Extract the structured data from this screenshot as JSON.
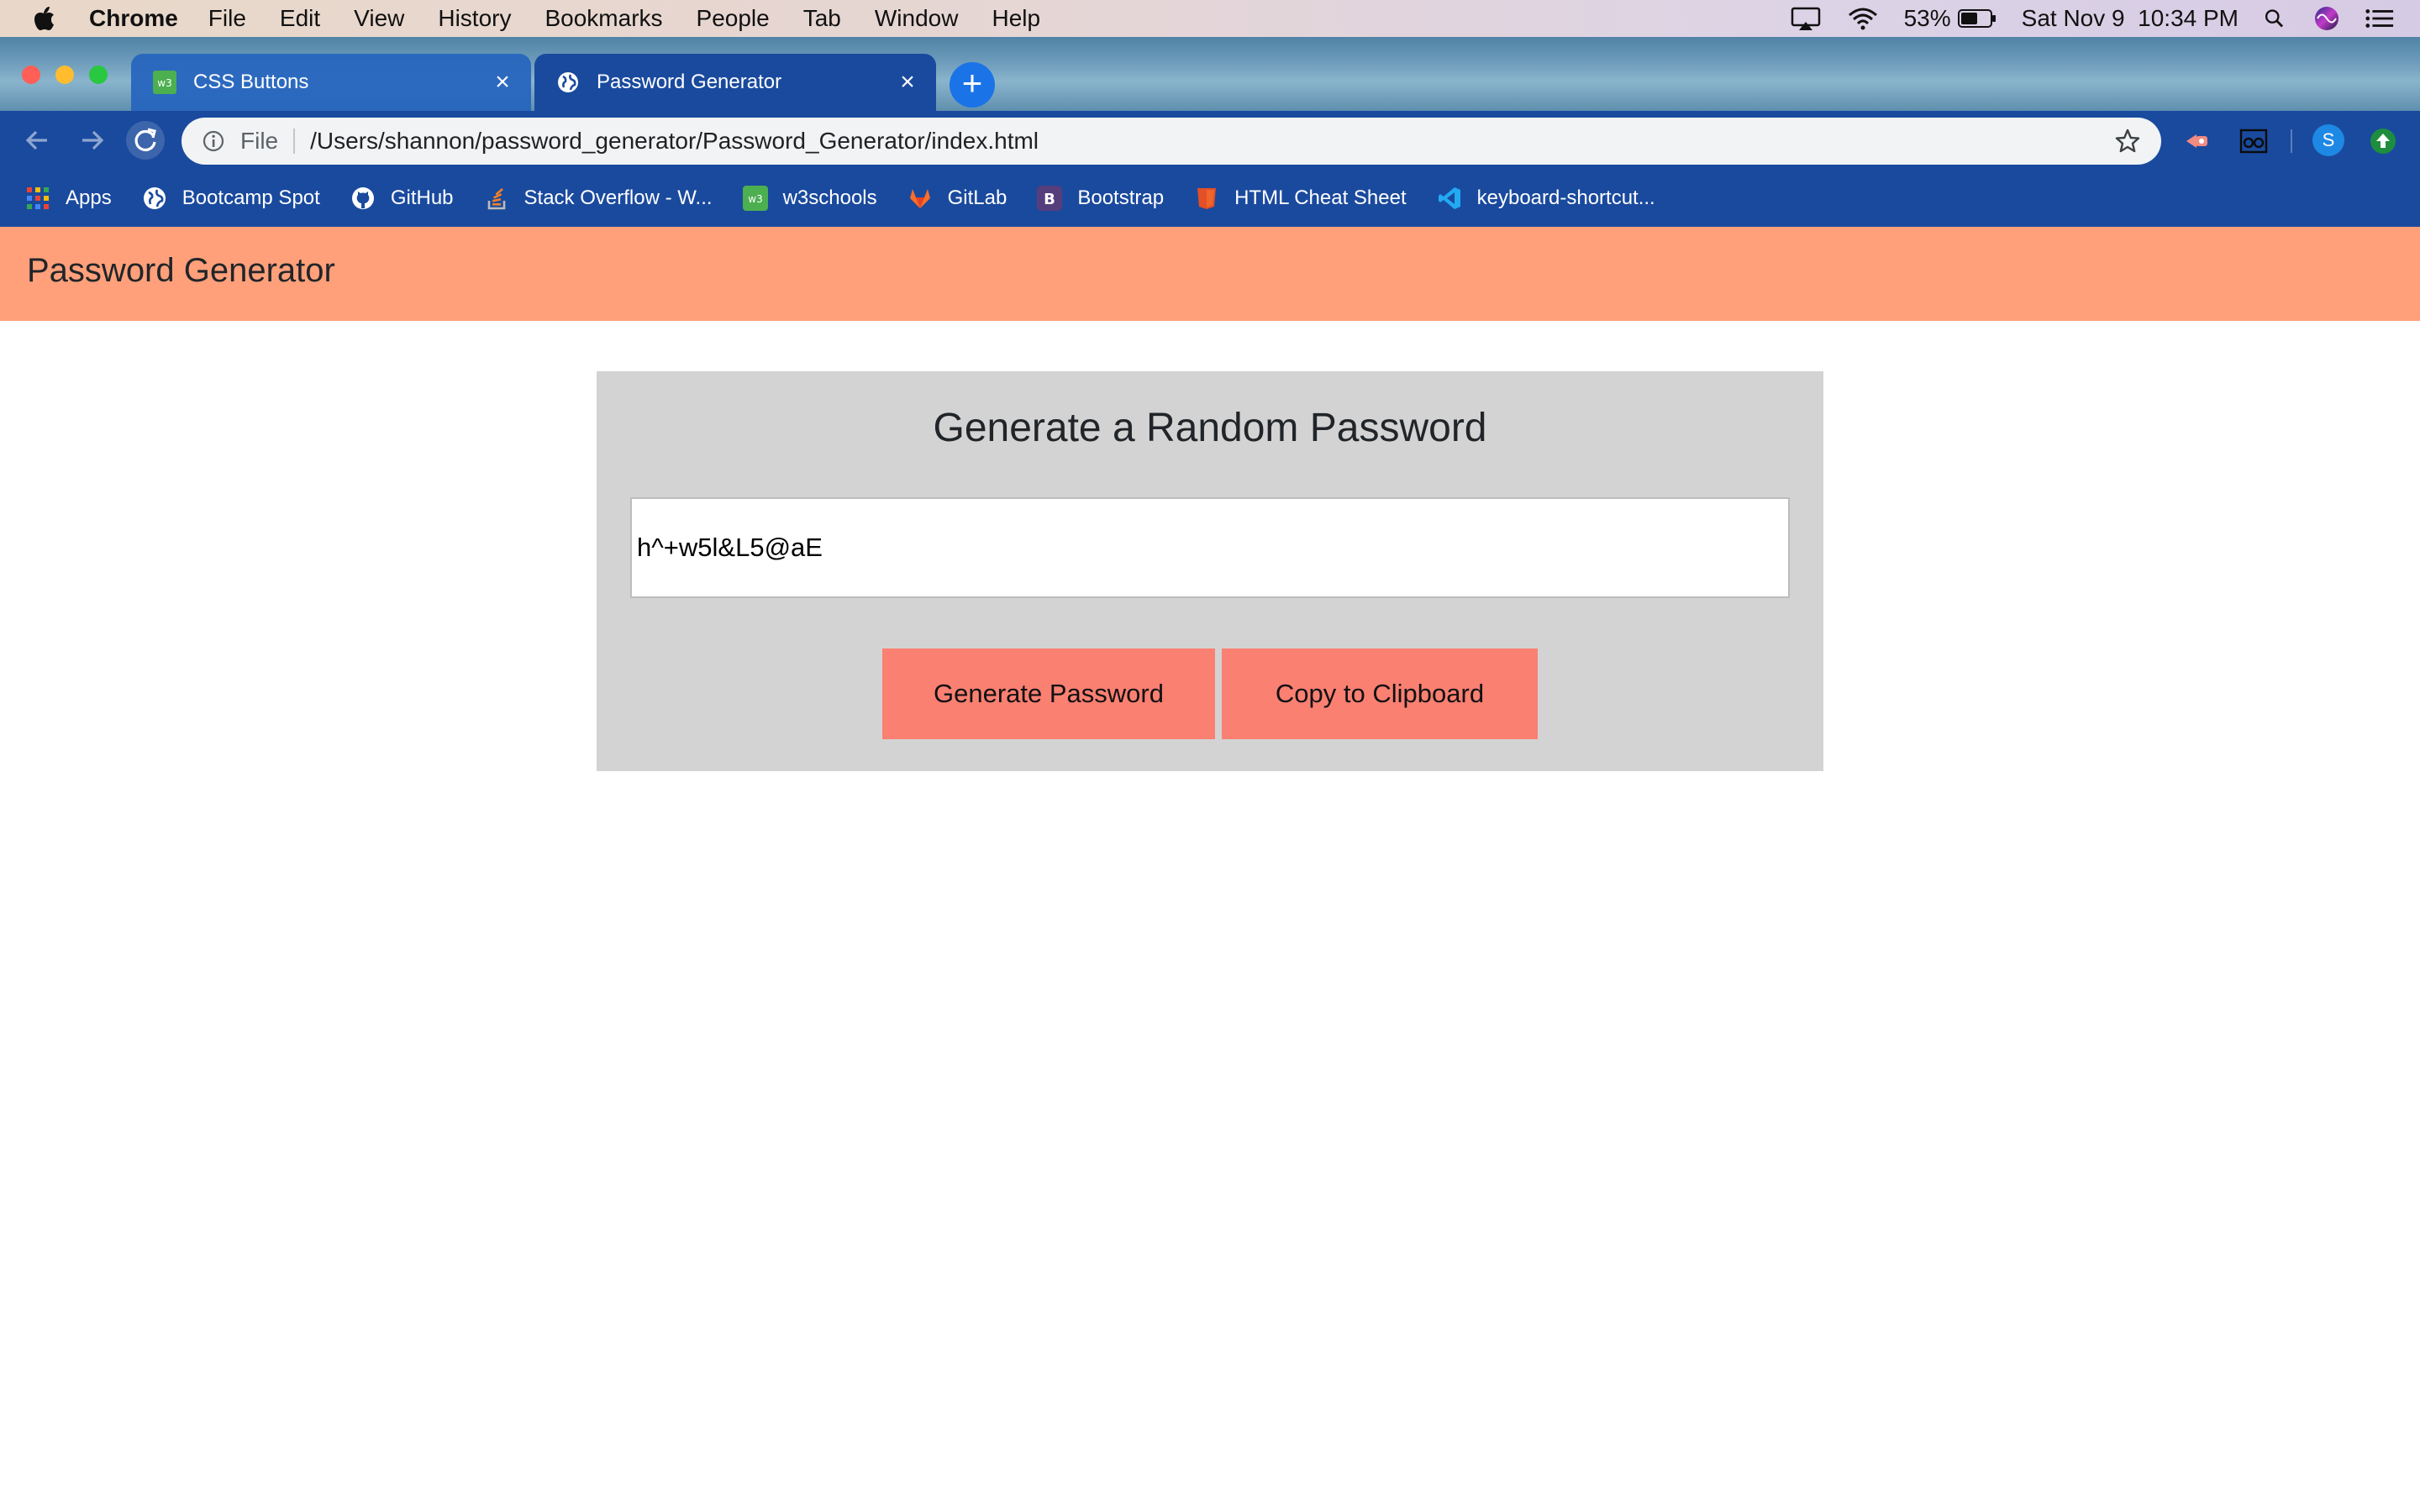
{
  "menubar": {
    "app_name": "Chrome",
    "items": [
      "File",
      "Edit",
      "View",
      "History",
      "Bookmarks",
      "People",
      "Tab",
      "Window",
      "Help"
    ],
    "battery": "53%",
    "clock": "Sat Nov 9  10:34 PM"
  },
  "browser": {
    "tabs": [
      {
        "title": "CSS Buttons",
        "icon": "w3schools-icon",
        "active": false
      },
      {
        "title": "Password Generator",
        "icon": "globe-icon",
        "active": true
      }
    ],
    "address": {
      "scheme_label": "File",
      "url": "/Users/shannon/password_generator/Password_Generator/index.html"
    },
    "profile_initial": "S",
    "bookmarks": [
      {
        "label": "Apps",
        "icon": "apps-grid-icon"
      },
      {
        "label": "Bootcamp Spot",
        "icon": "globe-icon"
      },
      {
        "label": "GitHub",
        "icon": "github-icon"
      },
      {
        "label": "Stack Overflow - W...",
        "icon": "stackoverflow-icon"
      },
      {
        "label": "w3schools",
        "icon": "w3schools-icon"
      },
      {
        "label": "GitLab",
        "icon": "gitlab-icon"
      },
      {
        "label": "Bootstrap",
        "icon": "bootstrap-icon"
      },
      {
        "label": "HTML Cheat Sheet",
        "icon": "html5-icon"
      },
      {
        "label": "keyboard-shortcut...",
        "icon": "vscode-icon"
      }
    ]
  },
  "page": {
    "header_title": "Password Generator",
    "card_title": "Generate a Random Password",
    "password_value": "h^+w5l&L5@aE",
    "generate_label": "Generate Password",
    "copy_label": "Copy to Clipboard"
  },
  "colors": {
    "header_bg": "#ffa07a",
    "card_bg": "#d3d3d3",
    "button_bg": "#fa8072",
    "browser_frame": "#1a4a9e"
  }
}
